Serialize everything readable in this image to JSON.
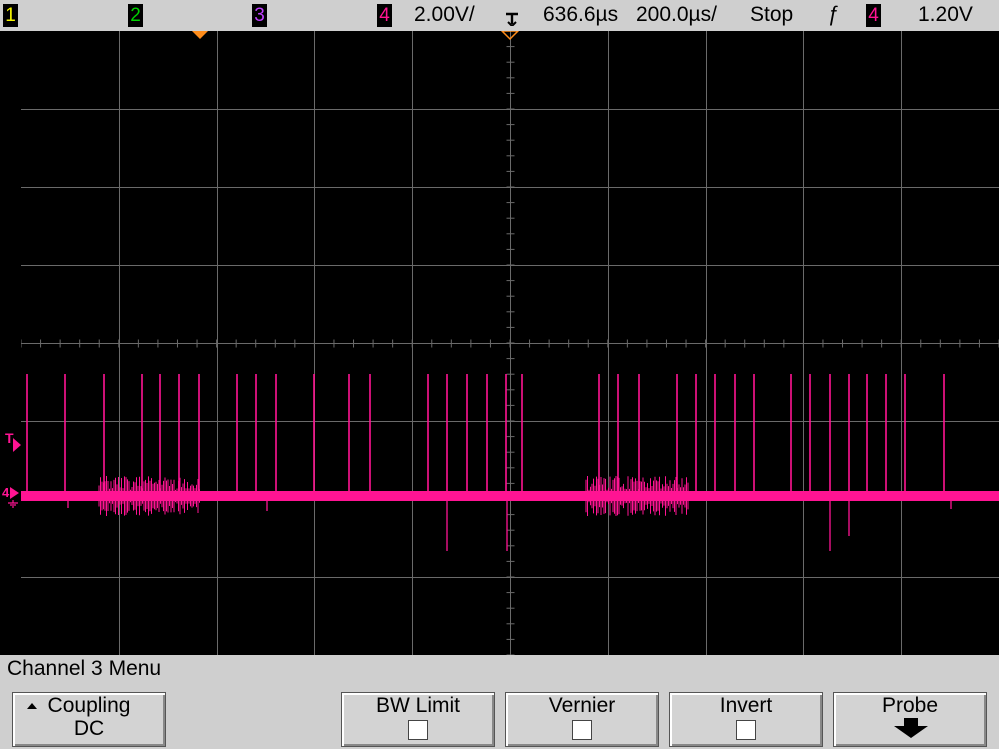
{
  "status_bar": {
    "ch1": "1",
    "ch2": "2",
    "ch3": "3",
    "ch4": "4",
    "ch4_scale": "2.00V/",
    "delay": "636.6µs",
    "timebase": "200.0µs/",
    "run_state": "Stop",
    "trigger_slope": "ƒ",
    "trigger_channel": "4",
    "trigger_level": "1.20V"
  },
  "screen": {
    "trigger_marker": "T",
    "channel4_marker": "4"
  },
  "menu": {
    "title": "Channel 3  Menu",
    "coupling_label": "Coupling",
    "coupling_value": "DC",
    "bw_limit_label": "BW Limit",
    "bw_limit_checked": false,
    "vernier_label": "Vernier",
    "vernier_checked": false,
    "invert_label": "Invert",
    "invert_checked": false,
    "probe_label": "Probe"
  },
  "colors": {
    "ch1": "#f5f500",
    "ch2": "#00d000",
    "ch3": "#c040ff",
    "ch4": "#ff1493",
    "grid": "#6a6a6a",
    "marker_orange": "#ff8c1a"
  }
}
